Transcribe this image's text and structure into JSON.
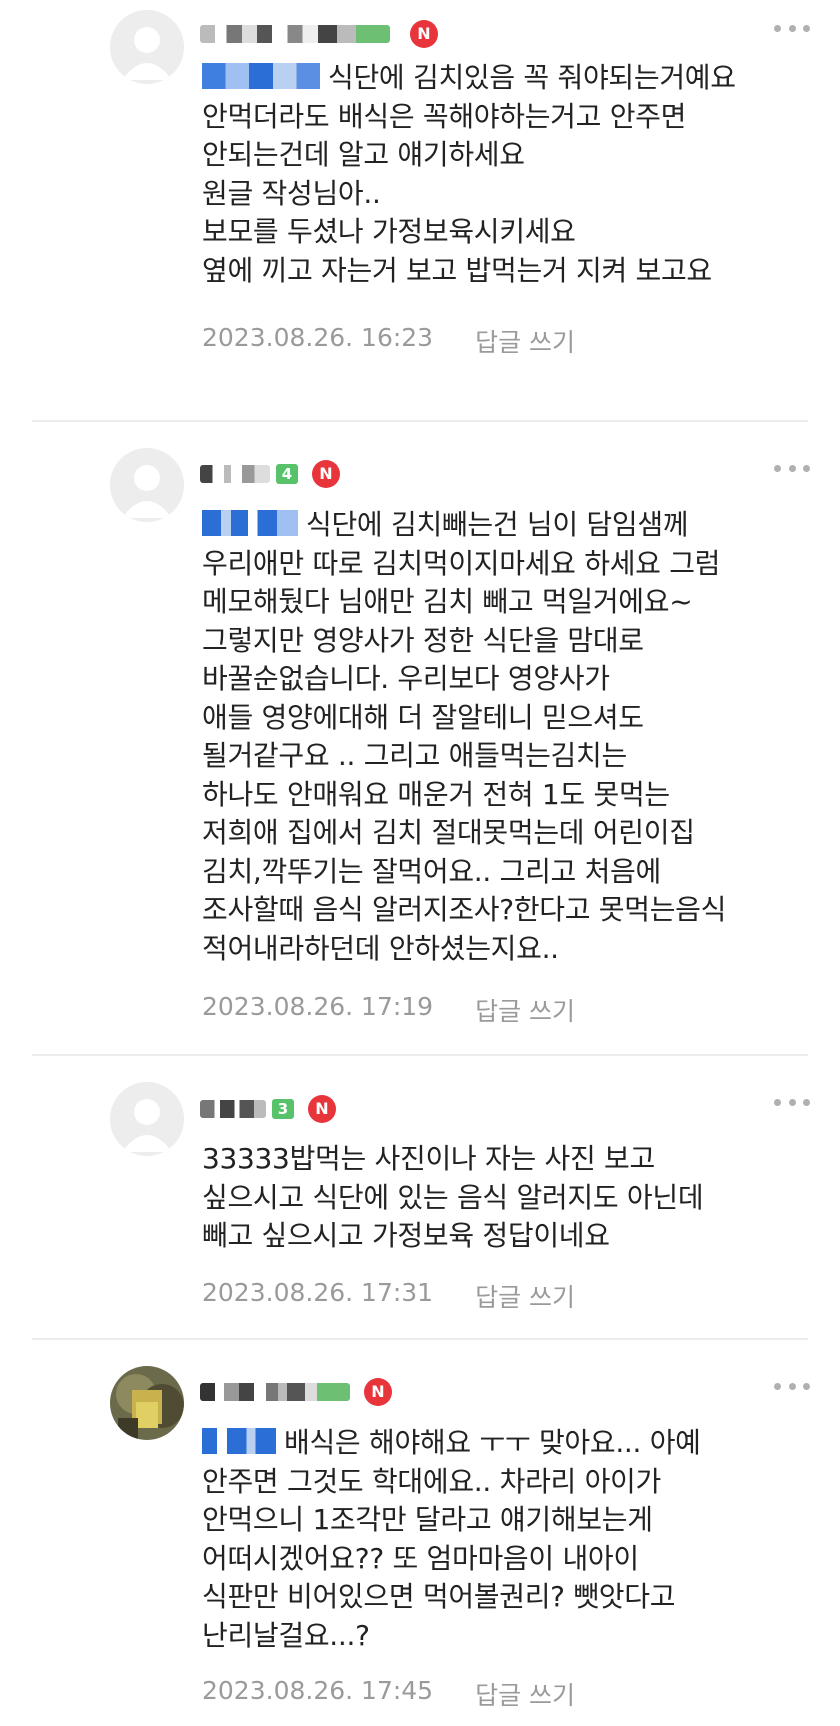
{
  "comments": [
    {
      "level": "",
      "lines": [
        "식단에 김치있음 꼭 줘야되는거예요",
        "안먹더라도 배식은 꼭해야하는거고 안주면",
        "안되는건데 알고 얘기하세요",
        "원글 작성님아..",
        "보모를 두셨나 가정보육시키세요",
        "옆에 끼고 자는거 보고 밥먹는거 지켜 보고요"
      ],
      "date": "2023.08.26. 16:23",
      "reply_label": "답글 쓰기"
    },
    {
      "level": "4",
      "lines": [
        "식단에 김치빼는건 님이 담임샘께",
        "우리애만 따로 김치먹이지마세요 하세요 그럼",
        "메모해뒀다 님애만 김치 빼고 먹일거에요~",
        "그렇지만 영양사가 정한 식단을 맘대로",
        "바꿀순없습니다. 우리보다 영양사가",
        "애들 영양에대해 더 잘알테니 믿으셔도",
        "될거같구요 .. 그리고 애들먹는김치는",
        "하나도 안매워요 매운거 전혀 1도 못먹는",
        "저희애 집에서 김치 절대못먹는데 어린이집",
        "김치,깍뚜기는 잘먹어요.. 그리고 처음에",
        "조사할때 음식 알러지조사?한다고 못먹는음식",
        "적어내라하던데 안하셨는지요.."
      ],
      "date": "2023.08.26. 17:19",
      "reply_label": "답글 쓰기"
    },
    {
      "level": "3",
      "lines": [
        "33333밥먹는 사진이나 자는 사진 보고",
        "싶으시고 식단에 있는 음식 알러지도 아닌데",
        "빼고 싶으시고 가정보육 정답이네요"
      ],
      "date": "2023.08.26. 17:31",
      "reply_label": "답글 쓰기"
    },
    {
      "level": "",
      "lines": [
        "배식은 해야해요 ㅜㅜ 맞아요... 아예",
        "안주면 그것도 학대에요.. 차라리 아이가",
        "안먹으니 1조각만 달라고 얘기해보는게",
        "어떠시겠어요?? 또 엄마마음이 내아이",
        "식판만 비어있으면 먹어볼권리? 뺏앗다고",
        "난리날걸요...?"
      ],
      "date": "2023.08.26. 17:45",
      "reply_label": "답글 쓰기"
    }
  ],
  "badge_letter": "N",
  "icons": {
    "avatar": "default-profile-avatar-icon",
    "more": "more-options-icon"
  },
  "colors": {
    "n_badge": "#e8343b",
    "level_badge": "#58c26b",
    "mention": "#2b6fd6",
    "meta_text": "#9a9a9a"
  }
}
